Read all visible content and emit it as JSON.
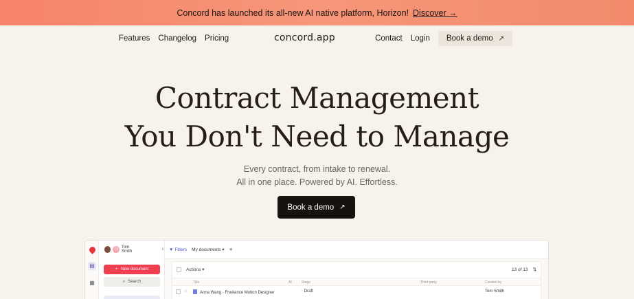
{
  "banner": {
    "text": "Concord has launched its all-new AI native platform, Horizon!",
    "link": "Discover →"
  },
  "nav": {
    "left": [
      "Features",
      "Changelog",
      "Pricing"
    ],
    "logo": "concord.app",
    "contact": "Contact",
    "login": "Login",
    "demo": "Book a demo",
    "demo_arrow": "↗"
  },
  "hero": {
    "title_line1": "Contract Management",
    "title_line2": "You Don't Need to Manage",
    "sub_line1": "Every contract, from intake to renewal.",
    "sub_line2": "All in one place. Powered by AI. Effortless.",
    "cta": "Book a demo",
    "cta_arrow": "↗"
  },
  "app": {
    "user": {
      "name": "Tom Smith",
      "initials": "TS"
    },
    "new_document": "New document",
    "new_icon": "+",
    "search": "Search",
    "search_icon": "⌕",
    "filters": "Filters",
    "my_documents": "My documents",
    "add": "+",
    "actions": "Actions",
    "count": "13 of 13",
    "columns": {
      "title": "Title",
      "ai": "AI",
      "stage": "Stage",
      "third_party": "Third party",
      "created_by": "Created by"
    },
    "rows": [
      {
        "title": "Anna Wang - Freelance Motion Designer",
        "stage": "Draft",
        "created_by": "Tom Smith"
      }
    ],
    "colors": {
      "accent": "#ef3f50",
      "filters": "#4c55c7"
    }
  }
}
